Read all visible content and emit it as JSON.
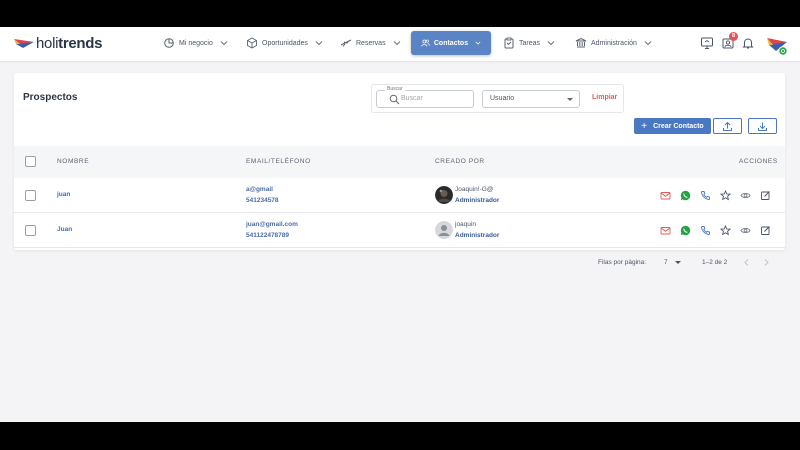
{
  "app": {
    "logo_light": "holi",
    "logo_bold": "trends"
  },
  "nav": {
    "items": [
      {
        "label": "Mi negocio",
        "icon": "pie-chart-icon"
      },
      {
        "label": "Oportunidades",
        "icon": "cube-icon"
      },
      {
        "label": "Reservas",
        "icon": "airplane-icon"
      },
      {
        "label": "Contactos",
        "icon": "users-icon",
        "active": true
      },
      {
        "label": "Tareas",
        "icon": "clipboard-icon"
      },
      {
        "label": "Administración",
        "icon": "bank-icon"
      }
    ],
    "notification_count": "8"
  },
  "page": {
    "title": "Prospectos",
    "search_label": "Buscar",
    "search_placeholder": "Buscar",
    "user_select_value": "Usuario",
    "clear_label": "Limpiar",
    "create_label": "Crear Contacto"
  },
  "table": {
    "columns": [
      "Nombre",
      "Email/Teléfono",
      "Creado por",
      "Acciones"
    ],
    "rows": [
      {
        "name": "juan",
        "email": "a@gmail",
        "phone": "541234578",
        "creator": "Joaquin!-G@",
        "role": "Administrador",
        "avatar": "photo"
      },
      {
        "name": "Juan",
        "email": "juan@gmail.com",
        "phone": "541122478789",
        "creator": "joaquin",
        "role": "Administrador",
        "avatar": "placeholder"
      }
    ]
  },
  "pagination": {
    "rows_per_page_label": "Filas por página:",
    "rows_per_page_value": "7",
    "range": "1–2 de 2"
  },
  "colors": {
    "accent": "#4a78c2",
    "active_nav": "#5b84c4",
    "danger": "#e05c5c",
    "whatsapp": "#25a244"
  }
}
